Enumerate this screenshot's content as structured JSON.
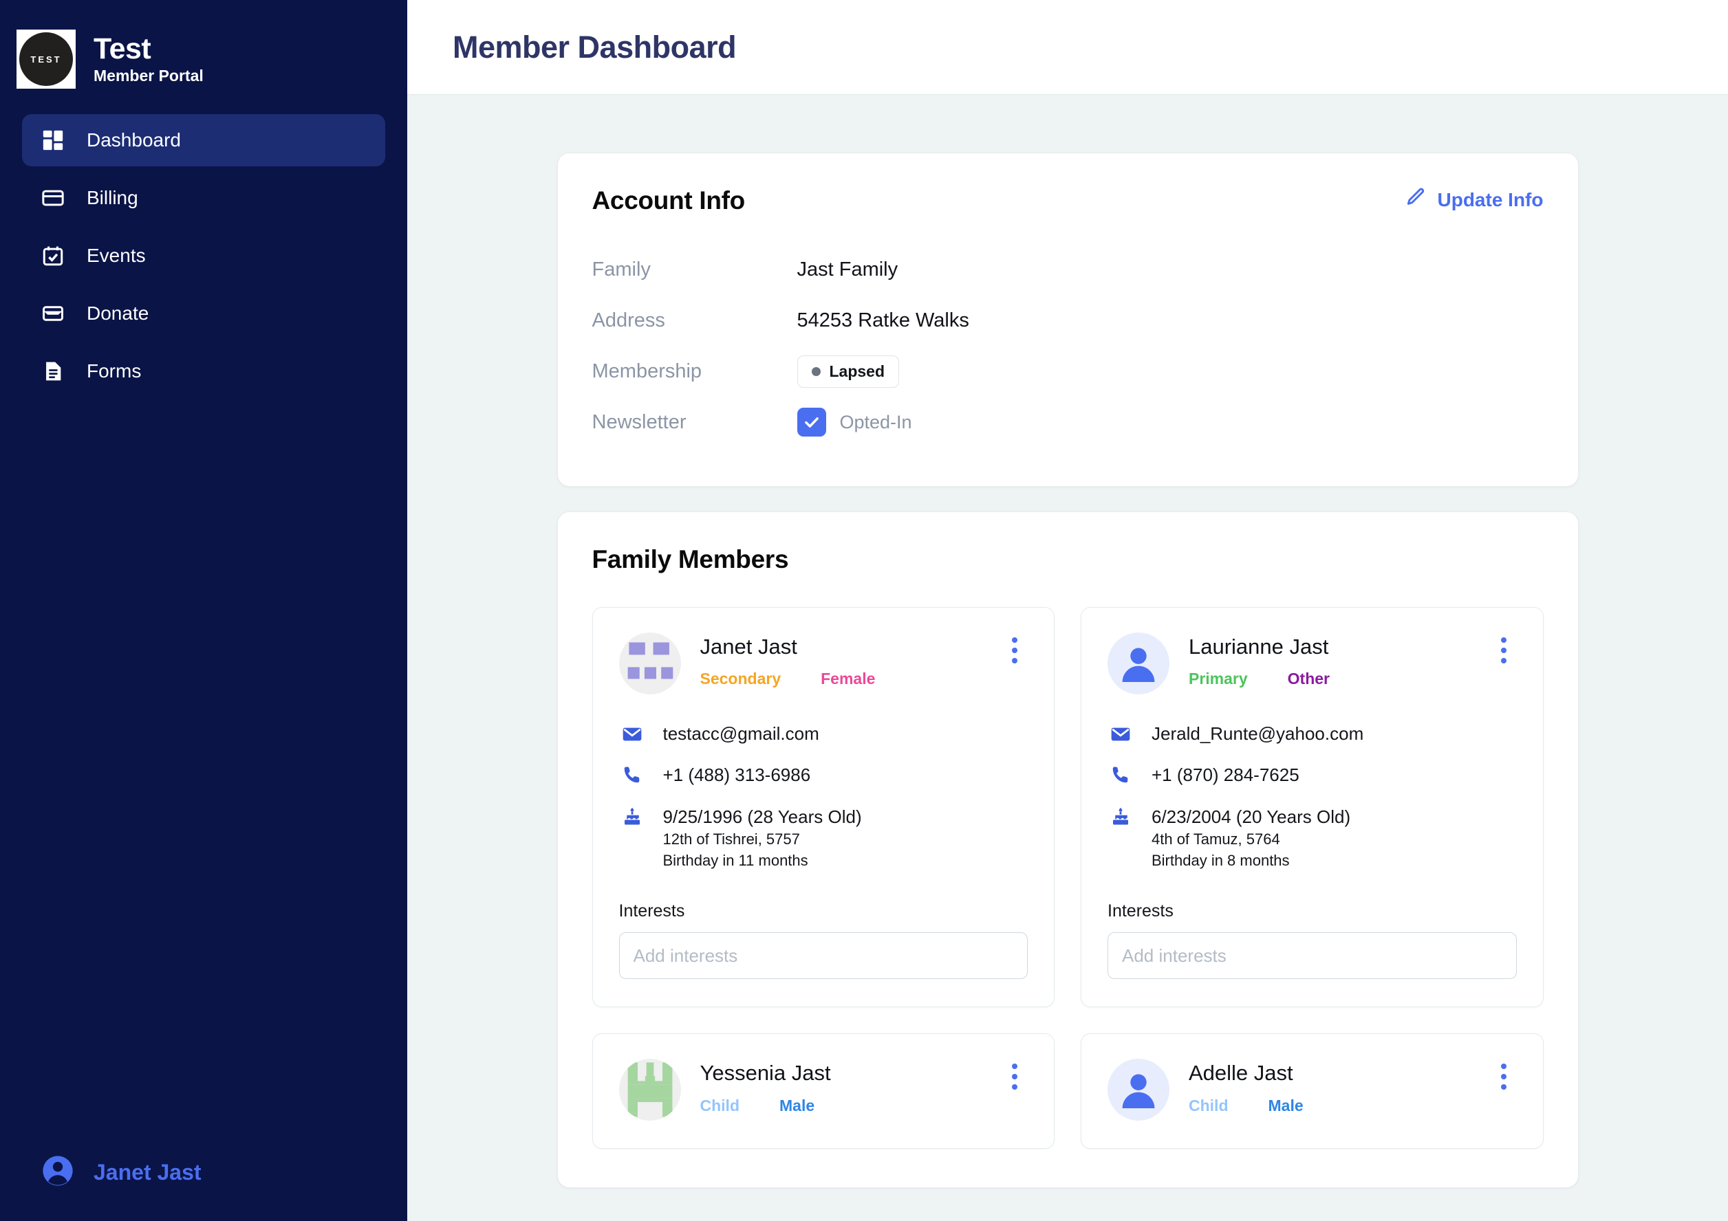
{
  "sidebar": {
    "logo_text": "TEST",
    "brand_title": "Test",
    "brand_subtitle": "Member Portal",
    "items": [
      {
        "label": "Dashboard",
        "icon": "dashboard-icon",
        "active": true
      },
      {
        "label": "Billing",
        "icon": "credit-card-icon",
        "active": false
      },
      {
        "label": "Events",
        "icon": "calendar-check-icon",
        "active": false
      },
      {
        "label": "Donate",
        "icon": "wallet-icon",
        "active": false
      },
      {
        "label": "Forms",
        "icon": "document-icon",
        "active": false
      }
    ],
    "user": {
      "name": "Janet Jast",
      "icon": "user-circle-icon"
    }
  },
  "header": {
    "title": "Member Dashboard"
  },
  "account_info": {
    "title": "Account Info",
    "update_label": "Update Info",
    "update_icon": "pencil-icon",
    "rows": [
      {
        "label": "Family",
        "value": "Jast Family",
        "type": "text"
      },
      {
        "label": "Address",
        "value": "54253 Ratke Walks",
        "type": "text"
      },
      {
        "label": "Membership",
        "value": "Lapsed",
        "type": "badge"
      },
      {
        "label": "Newsletter",
        "value": "Opted-In",
        "type": "checkbox",
        "checked": true
      }
    ]
  },
  "family_members": {
    "title": "Family Members",
    "interests_label": "Interests",
    "interests_placeholder": "Add interests",
    "members": [
      {
        "name": "Janet Jast",
        "role": "Secondary",
        "role_color": "#F5A623",
        "gender": "Female",
        "gender_color": "#EC4899",
        "email": "testacc@gmail.com",
        "phone": "+1 (488) 313-6986",
        "birthday": "9/25/1996 (28 Years Old)",
        "hebrew_date": "12th of Tishrei, 5757",
        "birthday_in": "Birthday in 11 months",
        "avatar_type": "identicon",
        "avatar_color": "#9b95dd",
        "avatar_bg": "#efefef"
      },
      {
        "name": "Laurianne Jast",
        "role": "Primary",
        "role_color": "#4CC45C",
        "gender": "Other",
        "gender_color": "#8B1A9E",
        "email": "Jerald_Runte@yahoo.com",
        "phone": "+1 (870) 284-7625",
        "birthday": "6/23/2004 (20 Years Old)",
        "hebrew_date": "4th of Tamuz, 5764",
        "birthday_in": "Birthday in 8 months",
        "avatar_type": "person",
        "avatar_color": "#4a6ef0",
        "avatar_bg": "#e8edfd"
      },
      {
        "name": "Yessenia Jast",
        "role": "Child",
        "role_color": "#93C5FD",
        "gender": "Male",
        "gender_color": "#2E86E6",
        "avatar_type": "identicon2",
        "avatar_color": "#a5d6a0",
        "avatar_bg": "#efefef"
      },
      {
        "name": "Adelle Jast",
        "role": "Child",
        "role_color": "#93C5FD",
        "gender": "Male",
        "gender_color": "#2E86E6",
        "avatar_type": "person",
        "avatar_color": "#4a6ef0",
        "avatar_bg": "#e8edfd"
      }
    ]
  },
  "colors": {
    "sidebar_bg": "#0a1446",
    "sidebar_active": "#1d2d74",
    "accent": "#4a6ef0",
    "page_bg": "#eef3f4",
    "title": "#2e3566"
  }
}
